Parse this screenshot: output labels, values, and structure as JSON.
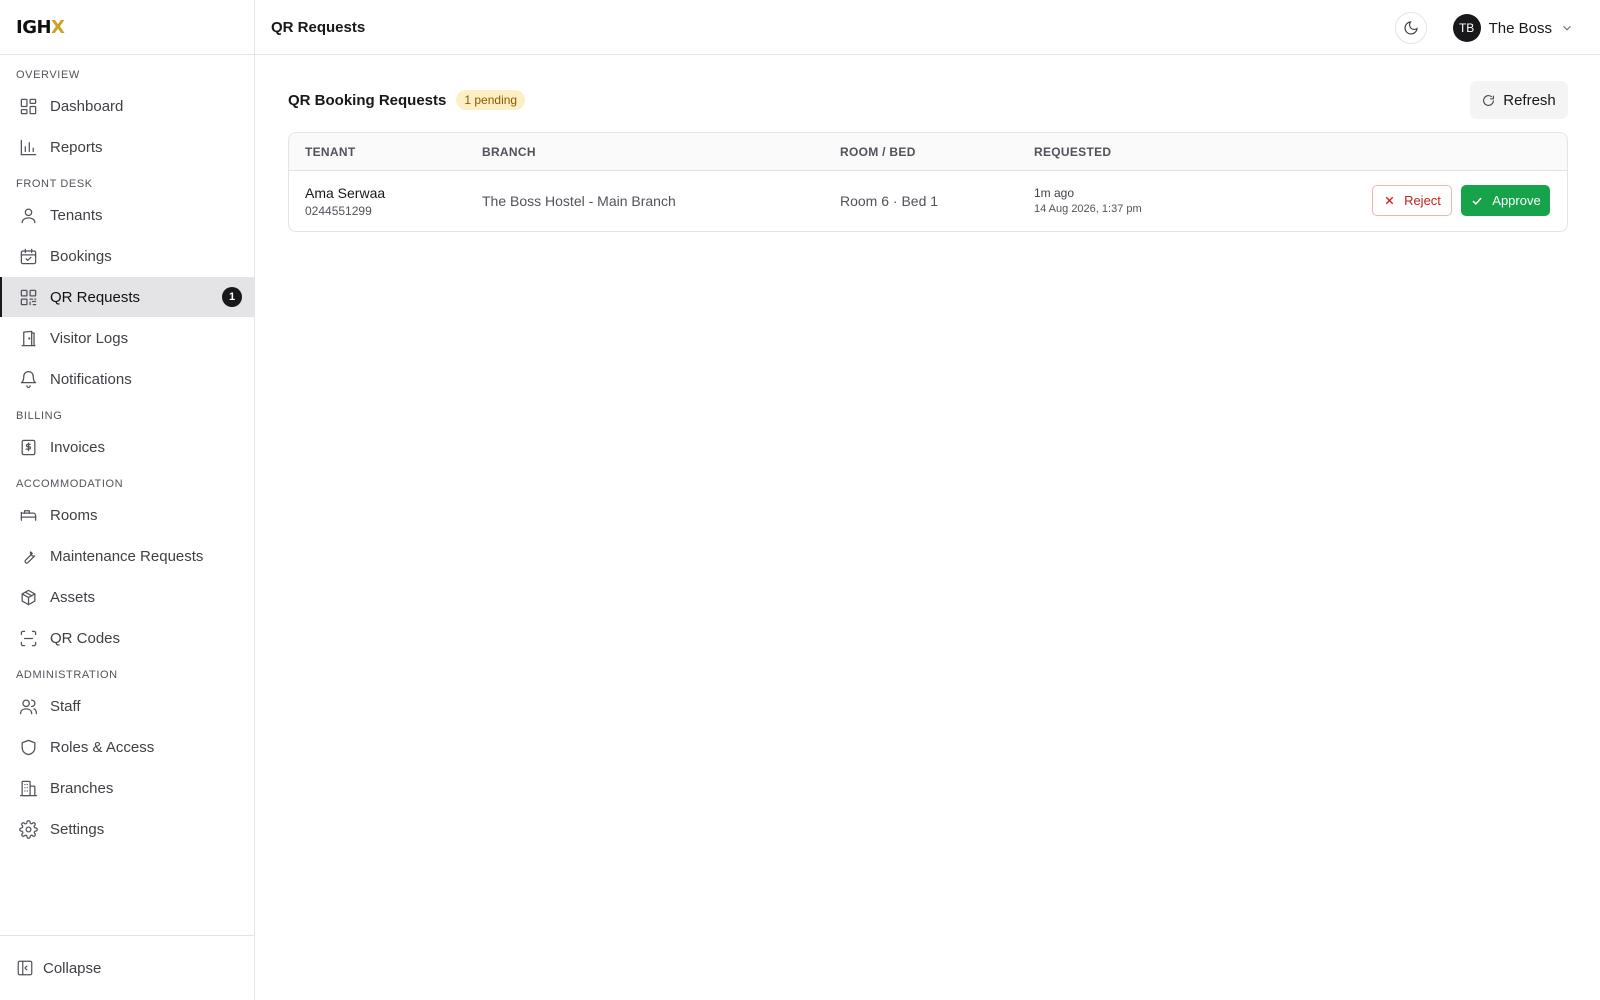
{
  "brand": {
    "logo_main": "IGH",
    "logo_accent": "X"
  },
  "header": {
    "title": "QR Requests",
    "user_initials": "TB",
    "user_name": "The Boss"
  },
  "sidebar": {
    "sections": [
      {
        "title": "Overview",
        "items": [
          {
            "label": "Dashboard",
            "icon": "dashboard-icon"
          },
          {
            "label": "Reports",
            "icon": "bar-chart-icon"
          }
        ]
      },
      {
        "title": "Front Desk",
        "items": [
          {
            "label": "Tenants",
            "icon": "user-icon"
          },
          {
            "label": "Bookings",
            "icon": "calendar-check-icon"
          },
          {
            "label": "QR Requests",
            "icon": "qr-icon",
            "active": true,
            "badge": "1"
          },
          {
            "label": "Visitor Logs",
            "icon": "door-icon"
          },
          {
            "label": "Notifications",
            "icon": "bell-icon"
          }
        ]
      },
      {
        "title": "Billing",
        "items": [
          {
            "label": "Invoices",
            "icon": "invoice-icon"
          }
        ]
      },
      {
        "title": "Accommodation",
        "items": [
          {
            "label": "Rooms",
            "icon": "bed-icon"
          },
          {
            "label": "Maintenance Requests",
            "icon": "wrench-icon"
          },
          {
            "label": "Assets",
            "icon": "box-icon"
          },
          {
            "label": "QR Codes",
            "icon": "scan-icon"
          }
        ]
      },
      {
        "title": "Administration",
        "items": [
          {
            "label": "Staff",
            "icon": "users-icon"
          },
          {
            "label": "Roles & Access",
            "icon": "shield-icon"
          },
          {
            "label": "Branches",
            "icon": "building-icon"
          },
          {
            "label": "Settings",
            "icon": "gear-icon"
          }
        ]
      }
    ],
    "collapse_label": "Collapse"
  },
  "main": {
    "card_title": "QR Booking Requests",
    "pending_badge": "1 pending",
    "refresh_label": "Refresh",
    "columns": {
      "tenant": "TENANT",
      "branch": "BRANCH",
      "room": "ROOM / BED",
      "requested": "REQUESTED"
    },
    "rows": [
      {
        "tenant_name": "Ama Serwaa",
        "tenant_phone": "0244551299",
        "branch": "The Boss Hostel - Main Branch",
        "room": "Room 6 · Bed 1",
        "requested_ago": "1m ago",
        "requested_date": "14 Aug 2026, 1:37 pm",
        "reject_label": "Reject",
        "approve_label": "Approve"
      }
    ]
  },
  "colors": {
    "approve": "#16a34a",
    "reject": "#c81e1e",
    "pending_bg": "#fdefc3",
    "accent_logo": "#c9a227"
  }
}
